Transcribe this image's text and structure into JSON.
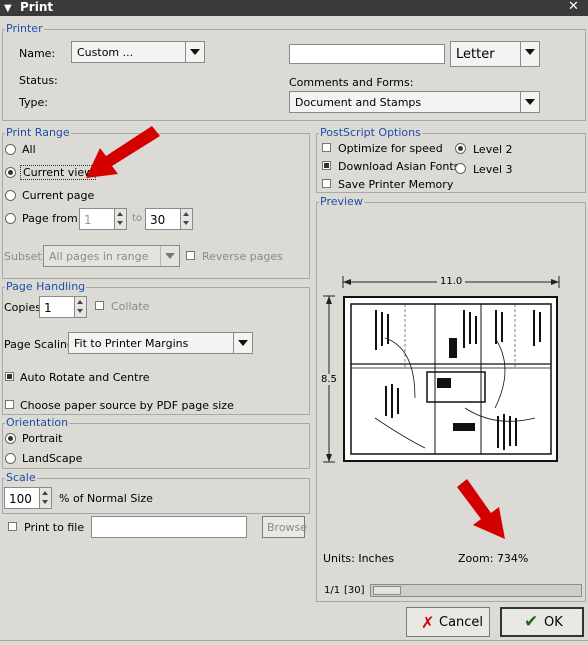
{
  "window": {
    "title": "Print"
  },
  "printer": {
    "group_label": "Printer",
    "name_label": "Name:",
    "name_value": "Custom ...",
    "status_label": "Status:",
    "type_label": "Type:",
    "paper_value": "Letter",
    "comments_label": "Comments and Forms:",
    "comments_value": "Document and Stamps"
  },
  "print_range": {
    "group_label": "Print Range",
    "all": "All",
    "current_view": "Current view",
    "current_page": "Current page",
    "pages_from": "Page from",
    "from_value": "1",
    "to_label": "to",
    "to_value": "30",
    "subset_label": "Subset:",
    "subset_value": "All pages in range",
    "reverse_label": "Reverse pages"
  },
  "postscript": {
    "group_label": "PostScript Options",
    "optimize": "Optimize for speed",
    "asian_fonts": "Download Asian Fonts",
    "save_memory": "Save Printer Memory",
    "level2": "Level 2",
    "level3": "Level 3"
  },
  "page_handling": {
    "group_label": "Page Handling",
    "copies_label": "Copies",
    "copies_value": "1",
    "collate_label": "Collate",
    "scaling_label": "Page Scaling",
    "scaling_value": "Fit to Printer Margins",
    "auto_rotate": "Auto Rotate and Centre",
    "paper_source": "Choose paper source by PDF page size"
  },
  "orientation": {
    "group_label": "Orientation",
    "portrait": "Portrait",
    "landscape": "LandScape"
  },
  "scale": {
    "group_label": "Scale",
    "value": "100",
    "suffix": "% of Normal Size"
  },
  "print_to_file": {
    "label": "Print to file",
    "browse": "Browse"
  },
  "preview": {
    "group_label": "Preview",
    "width_label": "11.0",
    "height_label": "8.5",
    "units": "Units: Inches",
    "zoom": "Zoom: 734%",
    "page_counter": "1/1",
    "page_total": "[30]"
  },
  "buttons": {
    "cancel": "Cancel",
    "ok": "OK"
  },
  "colors": {
    "arrow": "#d40000",
    "group_label": "#1d4fa8"
  }
}
